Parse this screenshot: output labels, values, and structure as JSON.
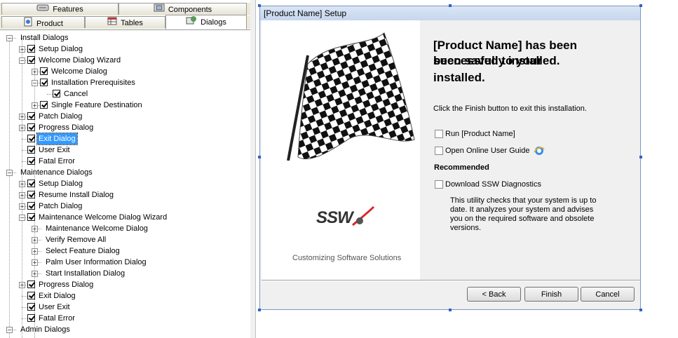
{
  "tabs_row1": [
    {
      "label": "Features",
      "icon": "features-icon"
    },
    {
      "label": "Components",
      "icon": "components-icon"
    }
  ],
  "tabs_row2": [
    {
      "label": "Product",
      "icon": "product-icon"
    },
    {
      "label": "Tables",
      "icon": "tables-icon"
    },
    {
      "label": "Dialogs",
      "icon": "dialogs-icon",
      "active": true
    }
  ],
  "tree": [
    {
      "label": "Install Dialogs",
      "level": 0,
      "expander": "minus",
      "checkbox": false
    },
    {
      "label": "Setup Dialog",
      "level": 1,
      "expander": "plus",
      "checkbox": true
    },
    {
      "label": "Welcome Dialog Wizard",
      "level": 1,
      "expander": "minus",
      "checkbox": true
    },
    {
      "label": "Welcome Dialog",
      "level": 2,
      "expander": "plus",
      "checkbox": true
    },
    {
      "label": "Installation Prerequisites",
      "level": 2,
      "expander": "minus",
      "checkbox": true
    },
    {
      "label": "Cancel",
      "level": 3,
      "expander": "none",
      "checkbox": true
    },
    {
      "label": "Single Feature Destination",
      "level": 2,
      "expander": "plus",
      "checkbox": true
    },
    {
      "label": "Patch Dialog",
      "level": 1,
      "expander": "plus",
      "checkbox": true
    },
    {
      "label": "Progress Dialog",
      "level": 1,
      "expander": "plus",
      "checkbox": true
    },
    {
      "label": "Exit Dialog",
      "level": 1,
      "expander": "none",
      "checkbox": true,
      "selected": true
    },
    {
      "label": "User Exit",
      "level": 1,
      "expander": "none",
      "checkbox": true
    },
    {
      "label": "Fatal Error",
      "level": 1,
      "expander": "none",
      "checkbox": true
    },
    {
      "label": "Maintenance Dialogs",
      "level": 0,
      "expander": "minus",
      "checkbox": false
    },
    {
      "label": "Setup Dialog",
      "level": 1,
      "expander": "plus",
      "checkbox": true
    },
    {
      "label": "Resume Install Dialog",
      "level": 1,
      "expander": "plus",
      "checkbox": true
    },
    {
      "label": "Patch Dialog",
      "level": 1,
      "expander": "plus",
      "checkbox": true
    },
    {
      "label": "Maintenance Welcome Dialog Wizard",
      "level": 1,
      "expander": "minus",
      "checkbox": true
    },
    {
      "label": "Maintenance Welcome Dialog",
      "level": 2,
      "expander": "plus",
      "checkbox": false
    },
    {
      "label": "Verify Remove All",
      "level": 2,
      "expander": "plus",
      "checkbox": false
    },
    {
      "label": "Select Feature Dialog",
      "level": 2,
      "expander": "plus",
      "checkbox": false
    },
    {
      "label": "Palm User Information Dialog",
      "level": 2,
      "expander": "plus",
      "checkbox": false
    },
    {
      "label": "Start Installation Dialog",
      "level": 2,
      "expander": "plus",
      "checkbox": false
    },
    {
      "label": "Progress Dialog",
      "level": 1,
      "expander": "plus",
      "checkbox": true
    },
    {
      "label": "Exit Dialog",
      "level": 1,
      "expander": "none",
      "checkbox": true
    },
    {
      "label": "User Exit",
      "level": 1,
      "expander": "none",
      "checkbox": true
    },
    {
      "label": "Fatal Error",
      "level": 1,
      "expander": "none",
      "checkbox": true
    },
    {
      "label": "Admin Dialogs",
      "level": 0,
      "expander": "minus",
      "checkbox": false
    }
  ],
  "dialog": {
    "title": "[Product Name] Setup",
    "headline_line1": "[Product Name] has been",
    "headline_line2": "successfully installed.",
    "headline_overlap": "been saved to your",
    "headline_line3": "installed.",
    "instruction": "Click the Finish button to exit this installation.",
    "run_label": "Run [Product Name]",
    "guide_label": "Open Online User Guide",
    "recommended": "Recommended",
    "diagnostics_label": "Download SSW Diagnostics",
    "description": "This utility checks that your system is up to date. It analyzes your system and advises you on the required software and obsolete versions.",
    "logo_text": "SSW",
    "tagline": "Customizing Software Solutions",
    "back_label": "< Back",
    "finish_label": "Finish",
    "cancel_label": "Cancel"
  },
  "colors": {
    "selection": "#3399ff",
    "title_bar": "#c5d6ee",
    "logo_red": "#d9262b"
  }
}
